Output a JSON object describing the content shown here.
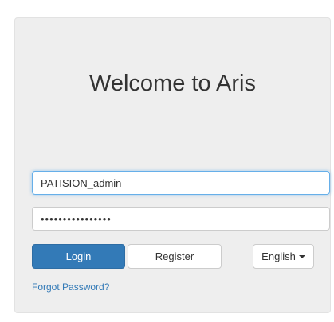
{
  "login": {
    "title": "Welcome to Aris",
    "username_value": "PATISION_admin",
    "password_value": "••••••••••••••••",
    "login_label": "Login",
    "register_label": "Register",
    "language_label": "English",
    "forgot_label": "Forgot Password?"
  },
  "colors": {
    "primary": "#337ab7",
    "panel_bg": "#eeeeee",
    "focus_border": "#66afe9"
  }
}
